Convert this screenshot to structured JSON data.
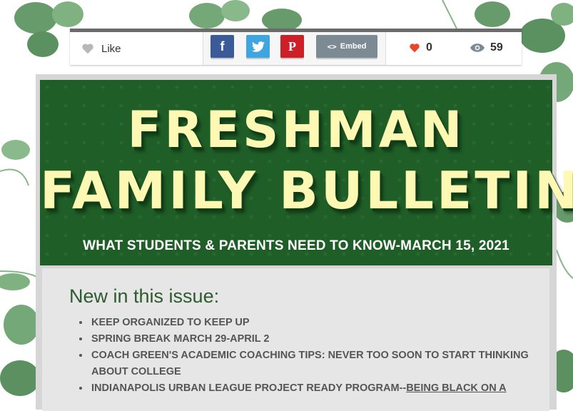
{
  "toolbar": {
    "like_label": "Like",
    "share_buttons": [
      {
        "name": "facebook",
        "glyph": "f",
        "color": "#3b5a98"
      },
      {
        "name": "twitter",
        "glyph": "bird",
        "color": "#3fa5de"
      },
      {
        "name": "pinterest",
        "glyph": "P",
        "color": "#cc1f27"
      }
    ],
    "embed_code_glyph": "<>",
    "embed_label": "Embed",
    "likes_count": "0",
    "views_count": "59"
  },
  "bulletin": {
    "title_line1": "FRESHMAN",
    "title_line2": "FAMILY BULLETIN",
    "subtitle": "WHAT STUDENTS & PARENTS NEED TO KNOW-MARCH 15, 2021",
    "banner_color": "#1f5f27",
    "title_color": "#fdf9b4"
  },
  "issue": {
    "heading": "New in this issue:",
    "items": [
      {
        "text": "KEEP ORGANIZED TO KEEP UP"
      },
      {
        "text": "SPRING BREAK MARCH 29-APRIL 2"
      },
      {
        "text": "COACH GREEN'S ACADEMIC COACHING TIPS: NEVER TOO SOON TO START THINKING ABOUT COLLEGE"
      },
      {
        "text": "INDIANAPOLIS URBAN LEAGUE PROJECT READY PROGRAM--",
        "link": "BEING BLACK ON A"
      }
    ]
  }
}
